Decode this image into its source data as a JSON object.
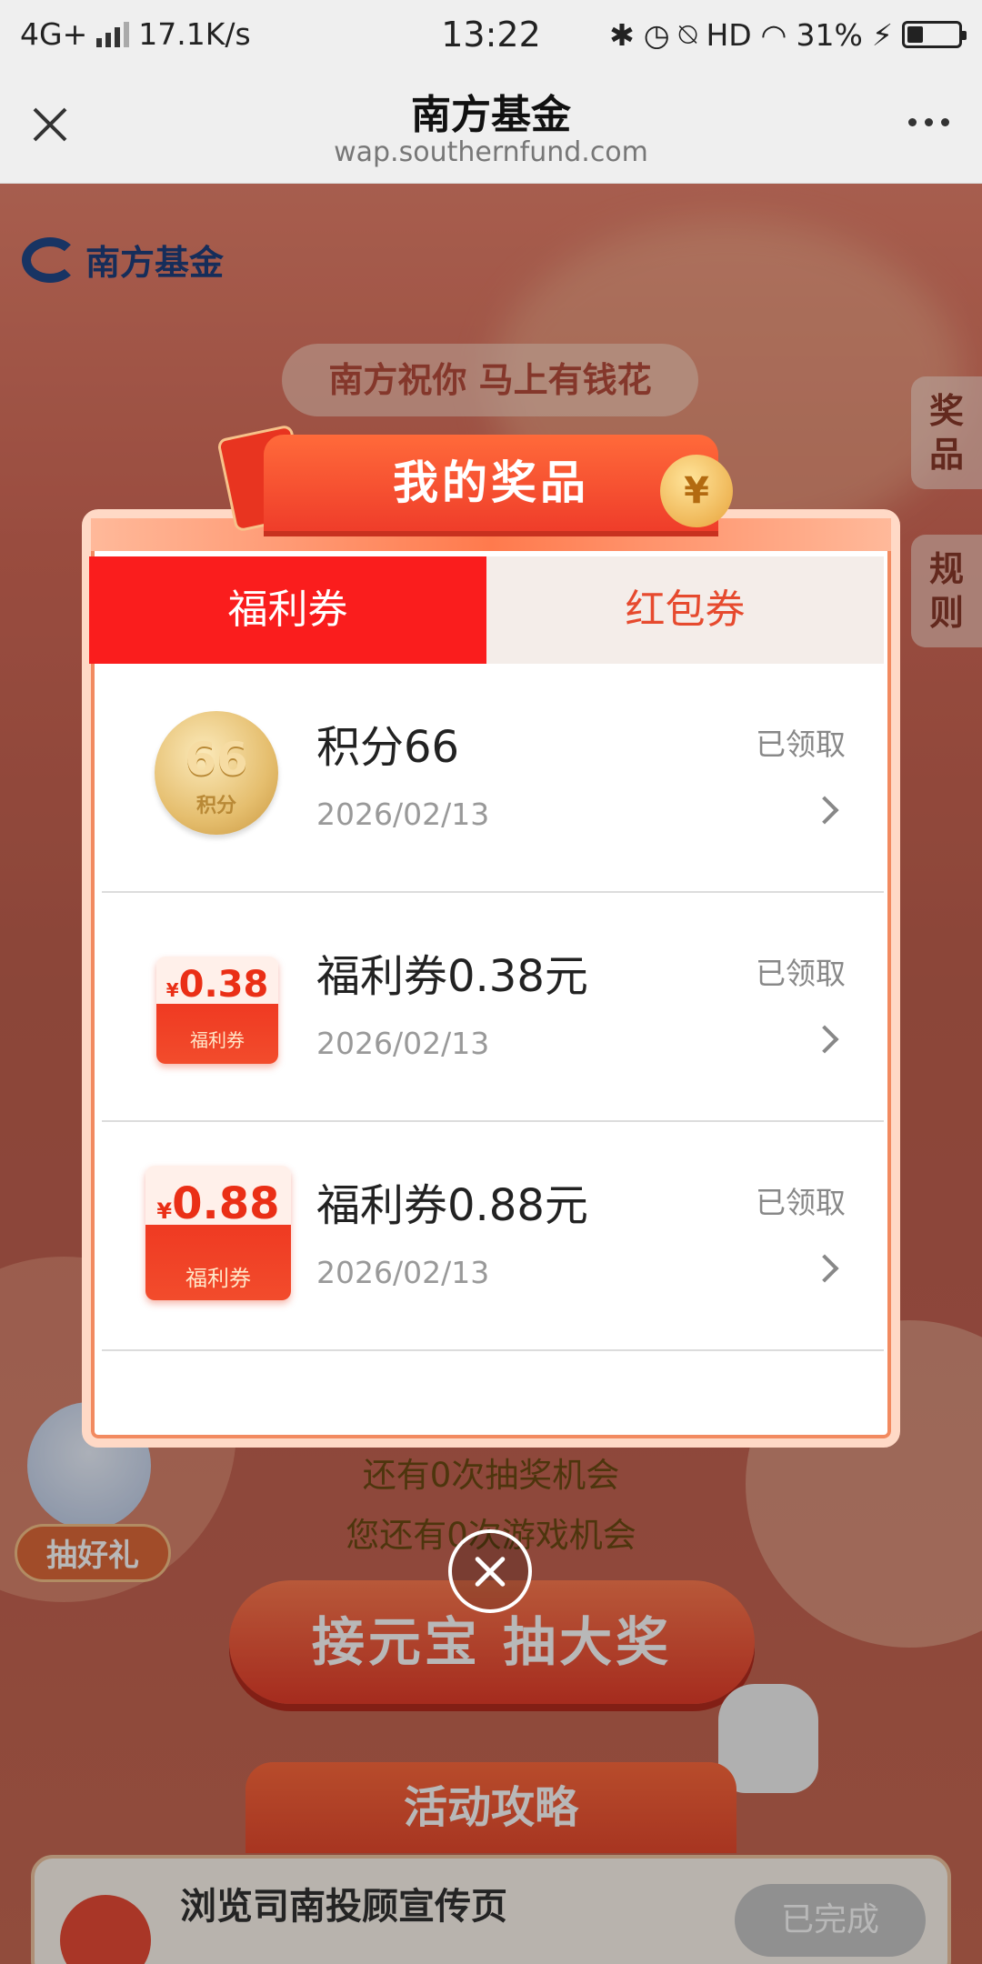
{
  "status_bar": {
    "network": "4G+",
    "speed": "17.1K/s",
    "time": "13:22",
    "hd": "HD",
    "battery_percent": "31%",
    "battery_level": 0.31
  },
  "browser": {
    "title": "南方基金",
    "url": "wap.southernfund.com",
    "close_icon": "close-icon",
    "more_icon": "more-dots-icon"
  },
  "background": {
    "logo_text": "南方基金",
    "wish_banner": "南方祝你 马上有钱花",
    "side_prizes": "奖品",
    "side_rules": "规则",
    "draw_chances": "还有0次抽奖机会",
    "game_chances": "您还有0次游戏机会",
    "draw_button": "接元宝 抽大奖",
    "gift_button": "抽好礼",
    "strategy_title": "活动攻略",
    "task_label": "浏览司南投顾宣传页",
    "task_button": "已完成"
  },
  "modal": {
    "title": "我的奖品",
    "coin_symbol": "¥",
    "tabs": [
      {
        "label": "福利券",
        "active": true
      },
      {
        "label": "红包券",
        "active": false
      }
    ],
    "prizes": [
      {
        "name": "积分66",
        "date": "2026/02/13",
        "status": "已领取",
        "badge_value": "66",
        "badge_unit": "积分"
      },
      {
        "name": "福利券0.38元",
        "date": "2026/02/13",
        "status": "已领取",
        "badge_currency": "¥",
        "badge_value": "0.38",
        "badge_unit": "福利券"
      },
      {
        "name": "福利券0.88元",
        "date": "2026/02/13",
        "status": "已领取",
        "badge_currency": "¥",
        "badge_value": "0.88",
        "badge_unit": "福利券"
      }
    ],
    "close_icon": "close-circle-icon"
  },
  "colors": {
    "accent_red": "#fa1d1d",
    "tab_inactive_text": "#e64a2e",
    "brand_blue": "#22488a"
  }
}
